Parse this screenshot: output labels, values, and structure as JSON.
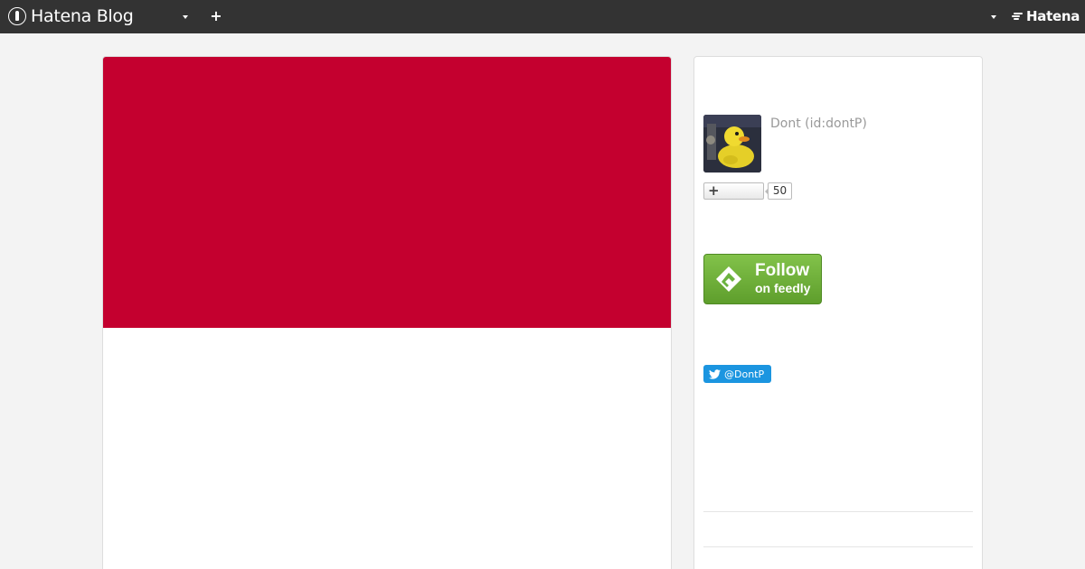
{
  "topbar": {
    "brand": "Hatena Blog",
    "account_logo": "Hatena",
    "icons": [
      "hatena-blog-icon",
      "caret-down-icon",
      "plus-icon",
      "hatena-icon"
    ]
  },
  "main": {
    "header_color": "#c4002f"
  },
  "sidebar": {
    "profile": {
      "name": "Dont (id:dontP)"
    },
    "subscribe": {
      "count": "50"
    },
    "feedly": {
      "follow_label": "Follow",
      "on_label": "on feedly"
    },
    "twitter": {
      "handle": "@DontP"
    }
  },
  "colors": {
    "topbar": "#333333",
    "page_background": "#f3f3f3",
    "feedly_green": "#6cb33f",
    "twitter_blue": "#1b95e0"
  }
}
